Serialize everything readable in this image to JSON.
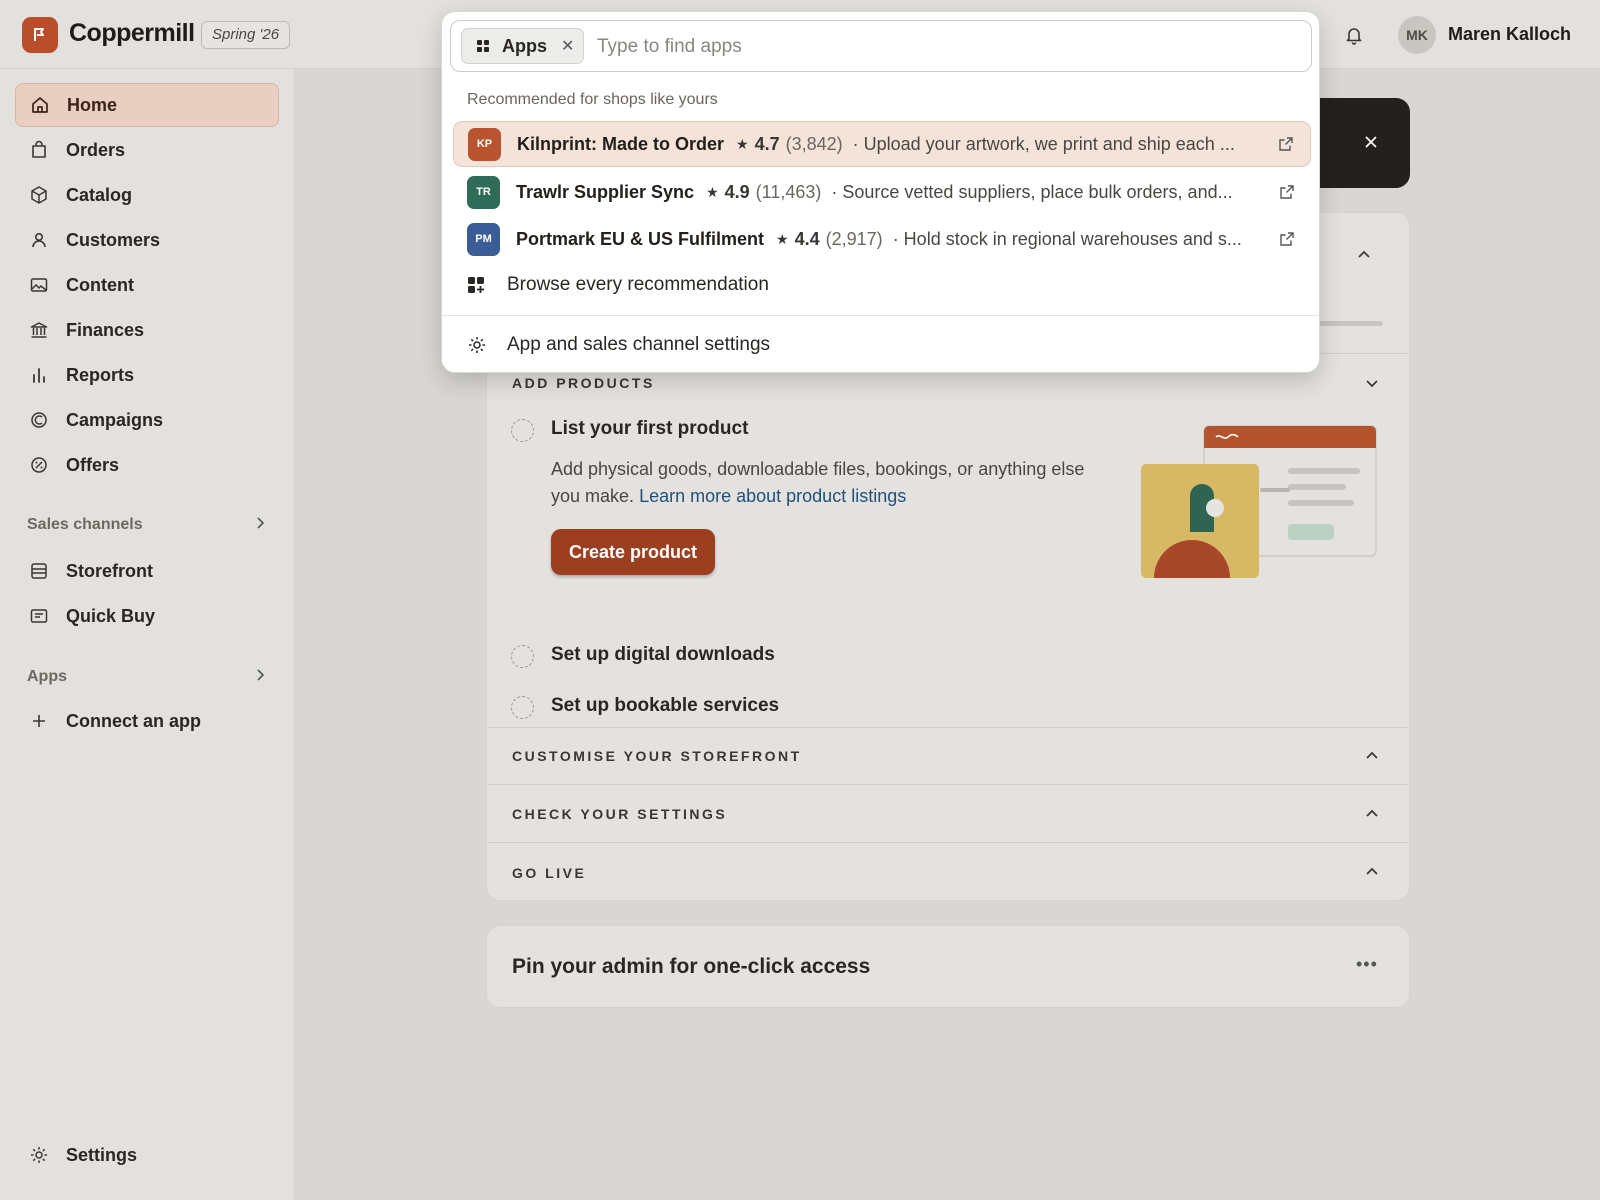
{
  "header": {
    "brand": "Coppermill",
    "release_badge": "Spring '26",
    "user": {
      "initials": "MK",
      "name": "Maren Kalloch"
    }
  },
  "sidebar": {
    "items": [
      {
        "label": "Home",
        "icon": "home-icon",
        "active": true
      },
      {
        "label": "Orders",
        "icon": "bag-icon"
      },
      {
        "label": "Catalog",
        "icon": "tag-icon"
      },
      {
        "label": "Customers",
        "icon": "person-icon"
      },
      {
        "label": "Content",
        "icon": "image-icon"
      },
      {
        "label": "Finances",
        "icon": "bank-icon"
      },
      {
        "label": "Reports",
        "icon": "bar-chart-icon"
      },
      {
        "label": "Campaigns",
        "icon": "target-icon"
      },
      {
        "label": "Offers",
        "icon": "discount-icon"
      }
    ],
    "sales_channels": {
      "heading": "Sales channels",
      "items": [
        {
          "label": "Storefront",
          "icon": "store-icon"
        },
        {
          "label": "Quick Buy",
          "icon": "receipt-icon"
        }
      ]
    },
    "apps": {
      "heading": "Apps",
      "items": [
        {
          "label": "Connect an app",
          "icon": "plus-icon"
        }
      ]
    },
    "settings_label": "Settings"
  },
  "search_dropdown": {
    "scope_chip": "Apps",
    "placeholder": "Type to find apps",
    "section_label": "Recommended for shops like yours",
    "apps": [
      {
        "initials": "KP",
        "color": "#b8542f",
        "name": "Kilnprint: Made to Order",
        "rating": "4.7",
        "reviews": "(3,842)",
        "description": "· Upload your artwork, we print and ship each ..."
      },
      {
        "initials": "TR",
        "color": "#2e6b58",
        "name": "Trawlr Supplier Sync",
        "rating": "4.9",
        "reviews": "(11,463)",
        "description": "· Source vetted suppliers, place bulk orders, and..."
      },
      {
        "initials": "PM",
        "color": "#3a5d97",
        "name": "Portmark EU & US Fulfilment",
        "rating": "4.4",
        "reviews": "(2,917)",
        "description": "· Hold stock in regional warehouses and s..."
      }
    ],
    "browse_label": "Browse every recommendation",
    "settings_label": "App and sales channel settings"
  },
  "setup_guide": {
    "sections": {
      "add_products": "ADD PRODUCTS",
      "customise": "CUSTOMISE YOUR STOREFRONT",
      "check_settings": "CHECK YOUR SETTINGS",
      "go_live": "GO LIVE"
    },
    "tasks": {
      "first_product": {
        "title": "List your first product",
        "description": "Add physical goods, downloadable files, bookings, or anything else you make.",
        "link": "Learn more about product listings",
        "button": "Create product"
      },
      "digital_downloads": "Set up digital downloads",
      "bookable_services": "Set up bookable services"
    }
  },
  "pin_card": {
    "title": "Pin your admin for one-click access"
  },
  "colors": {
    "accent": "#9c3f20",
    "brand": "#b84e2a",
    "active_nav": "#e9cfc2"
  }
}
